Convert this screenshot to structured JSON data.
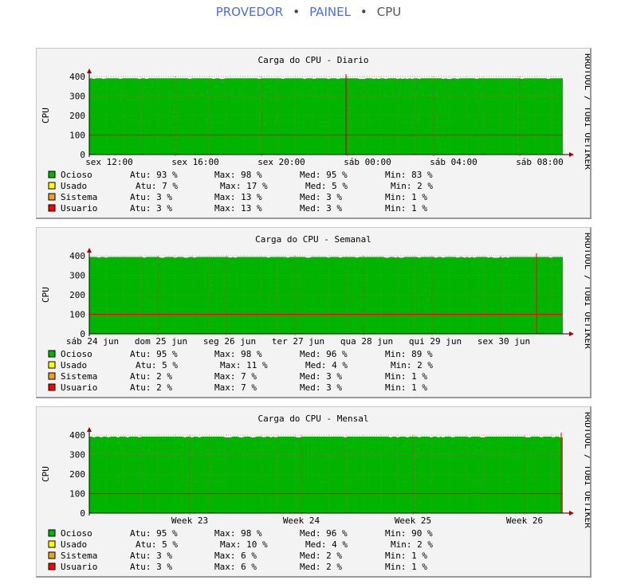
{
  "breadcrumb": {
    "items": [
      "PROVEDOR",
      "PAINEL"
    ],
    "current": "CPU",
    "separator": "•"
  },
  "watermark": "RRDTOOL / TOBI OETIKER",
  "colors": {
    "ocioso": "#00b400",
    "usado": "#ffff00",
    "sistema": "#f0a020",
    "usuario": "#ff0000",
    "threshold": "#ff0000",
    "link": "#4b6fe0"
  },
  "chart_data": [
    {
      "type": "area",
      "stacked": true,
      "title": "Carga do CPU - Diario",
      "ylabel": "CPU",
      "ylim": [
        0,
        400
      ],
      "yticks": [
        "0",
        "100",
        "200",
        "300",
        "400"
      ],
      "grid": true,
      "threshold": 100,
      "xticks": [
        "sex 12:00",
        "sex 16:00",
        "sex 20:00",
        "sáb 00:00",
        "sáb 04:00",
        "sáb 08:00"
      ],
      "series": [
        {
          "name": "Ocioso",
          "value": 380
        },
        {
          "name": "Usado",
          "value": 5
        },
        {
          "name": "Sistema",
          "value": 3
        },
        {
          "name": "Usuario",
          "value": 3
        }
      ],
      "legend": [
        {
          "name": "Ocioso",
          "atu": "93 %",
          "max": "98 %",
          "med": "95 %",
          "min": "83 %"
        },
        {
          "name": "Usado",
          "atu": "7 %",
          "max": "17 %",
          "med": "5 %",
          "min": "2 %"
        },
        {
          "name": "Sistema",
          "atu": "3 %",
          "max": "13 %",
          "med": "3 %",
          "min": "1 %"
        },
        {
          "name": "Usuario",
          "atu": "3 %",
          "max": "13 %",
          "med": "3 %",
          "min": "1 %"
        }
      ]
    },
    {
      "type": "area",
      "stacked": true,
      "title": "Carga do CPU - Semanal",
      "ylabel": "CPU",
      "ylim": [
        0,
        400
      ],
      "yticks": [
        "0",
        "100",
        "200",
        "300",
        "400"
      ],
      "grid": true,
      "threshold": 100,
      "xticks": [
        "sáb 24 jun",
        "dom 25 jun",
        "seg 26 jun",
        "ter 27 jun",
        "qua 28 jun",
        "qui 29 jun",
        "sex 30 jun"
      ],
      "series": [
        {
          "name": "Ocioso",
          "value": 384
        },
        {
          "name": "Usado",
          "value": 4
        },
        {
          "name": "Sistema",
          "value": 3
        },
        {
          "name": "Usuario",
          "value": 3
        }
      ],
      "legend": [
        {
          "name": "Ocioso",
          "atu": "95 %",
          "max": "98 %",
          "med": "96 %",
          "min": "89 %"
        },
        {
          "name": "Usado",
          "atu": "5 %",
          "max": "11 %",
          "med": "4 %",
          "min": "2 %"
        },
        {
          "name": "Sistema",
          "atu": "2 %",
          "max": "7 %",
          "med": "3 %",
          "min": "1 %"
        },
        {
          "name": "Usuario",
          "atu": "2 %",
          "max": "7 %",
          "med": "3 %",
          "min": "1 %"
        }
      ]
    },
    {
      "type": "area",
      "stacked": true,
      "title": "Carga do CPU - Mensal",
      "ylabel": "CPU",
      "ylim": [
        0,
        400
      ],
      "yticks": [
        "0",
        "100",
        "200",
        "300",
        "400"
      ],
      "grid": true,
      "threshold": 100,
      "xticks": [
        "Week 23",
        "Week 24",
        "Week 25",
        "Week 26"
      ],
      "series": [
        {
          "name": "Ocioso",
          "value": 384
        },
        {
          "name": "Usado",
          "value": 4
        },
        {
          "name": "Sistema",
          "value": 2
        },
        {
          "name": "Usuario",
          "value": 2
        }
      ],
      "legend": [
        {
          "name": "Ocioso",
          "atu": "95 %",
          "max": "98 %",
          "med": "96 %",
          "min": "90 %"
        },
        {
          "name": "Usado",
          "atu": "5 %",
          "max": "10 %",
          "med": "4 %",
          "min": "2 %"
        },
        {
          "name": "Sistema",
          "atu": "3 %",
          "max": "6 %",
          "med": "2 %",
          "min": "1 %"
        },
        {
          "name": "Usuario",
          "atu": "3 %",
          "max": "6 %",
          "med": "2 %",
          "min": "1 %"
        }
      ]
    }
  ]
}
